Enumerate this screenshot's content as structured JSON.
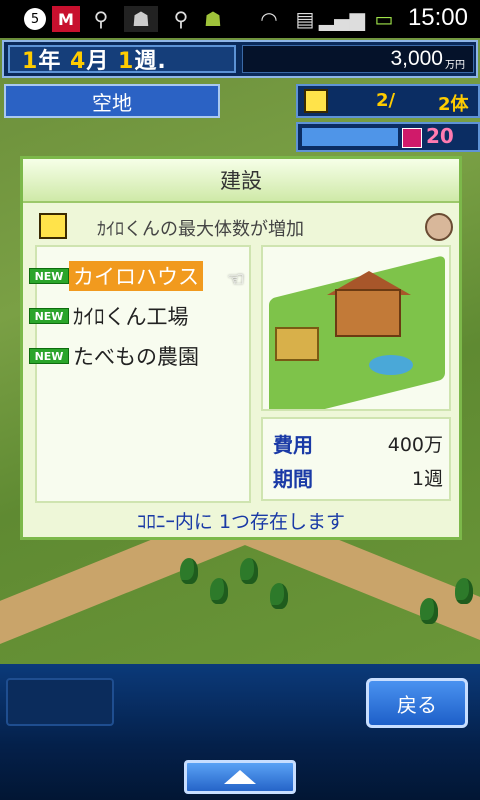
{
  "status_bar": {
    "time": "15:00",
    "notification_count": "5",
    "icons": [
      "notification-count-icon",
      "mcafee-icon",
      "usb-icon",
      "android-debug-icon",
      "usb-icon",
      "android-icon",
      "wifi-icon",
      "sd-card-icon",
      "signal-icon",
      "battery-charging-icon"
    ]
  },
  "header": {
    "date_year_num": "1",
    "date_year_unit": "年",
    "date_month_num": "4",
    "date_month_unit": "月",
    "date_week_num": "1",
    "date_week_unit": "週.",
    "money": "3,000",
    "money_unit": "万円"
  },
  "location": {
    "label": "空地"
  },
  "population": {
    "value1": "2/",
    "value2": "2体"
  },
  "meter": {
    "value": "20",
    "fill_fraction": 0.45
  },
  "dialog": {
    "title": "建設",
    "description": "ｶｲﾛくんの最大体数が増加",
    "items": [
      {
        "badge": "NEW",
        "label": "カイロハウス",
        "selected": true
      },
      {
        "badge": "NEW",
        "label": "ｶｲﾛくん工場",
        "selected": false
      },
      {
        "badge": "NEW",
        "label": "たべもの農園",
        "selected": false
      }
    ],
    "cost_label": "費用",
    "cost_value": "400万",
    "period_label": "期間",
    "period_value": "1週",
    "footer_note": "ｺﾛﾆｰ内に 1つ存在します"
  },
  "buttons": {
    "back_label": "戻る"
  },
  "colors": {
    "dialog_bg": "#eef7d8",
    "dialog_border": "#7cb84a",
    "selected_item": "#f19a1e",
    "accent_blue": "#2b62c4"
  }
}
